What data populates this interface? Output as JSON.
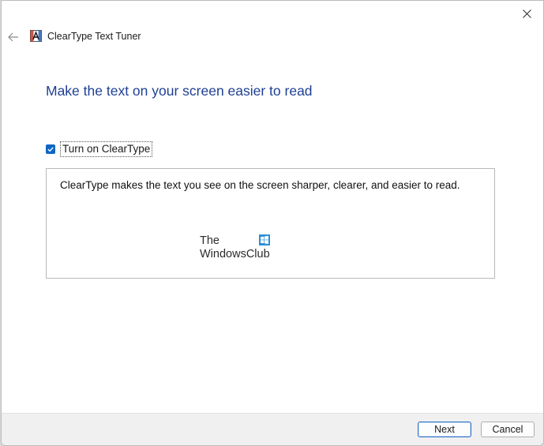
{
  "window": {
    "title": "ClearType Text Tuner"
  },
  "main": {
    "heading": "Make the text on your screen easier to read",
    "checkbox": {
      "label": "Turn on ClearType",
      "checked": true
    },
    "preview": {
      "text": "ClearType makes the text you see on the screen sharper, clearer, and easier to read.",
      "watermark_line1": "The",
      "watermark_line2": "WindowsClub"
    }
  },
  "footer": {
    "next_label": "Next",
    "cancel_label": "Cancel"
  },
  "icons": {
    "back": "back-arrow-icon",
    "app": "cleartype-app-icon",
    "close": "close-icon",
    "check": "checkmark-icon"
  },
  "colors": {
    "heading": "#1e3f94",
    "checkbox_fill": "#0f67c4",
    "default_button_border": "#2b6fc5"
  }
}
